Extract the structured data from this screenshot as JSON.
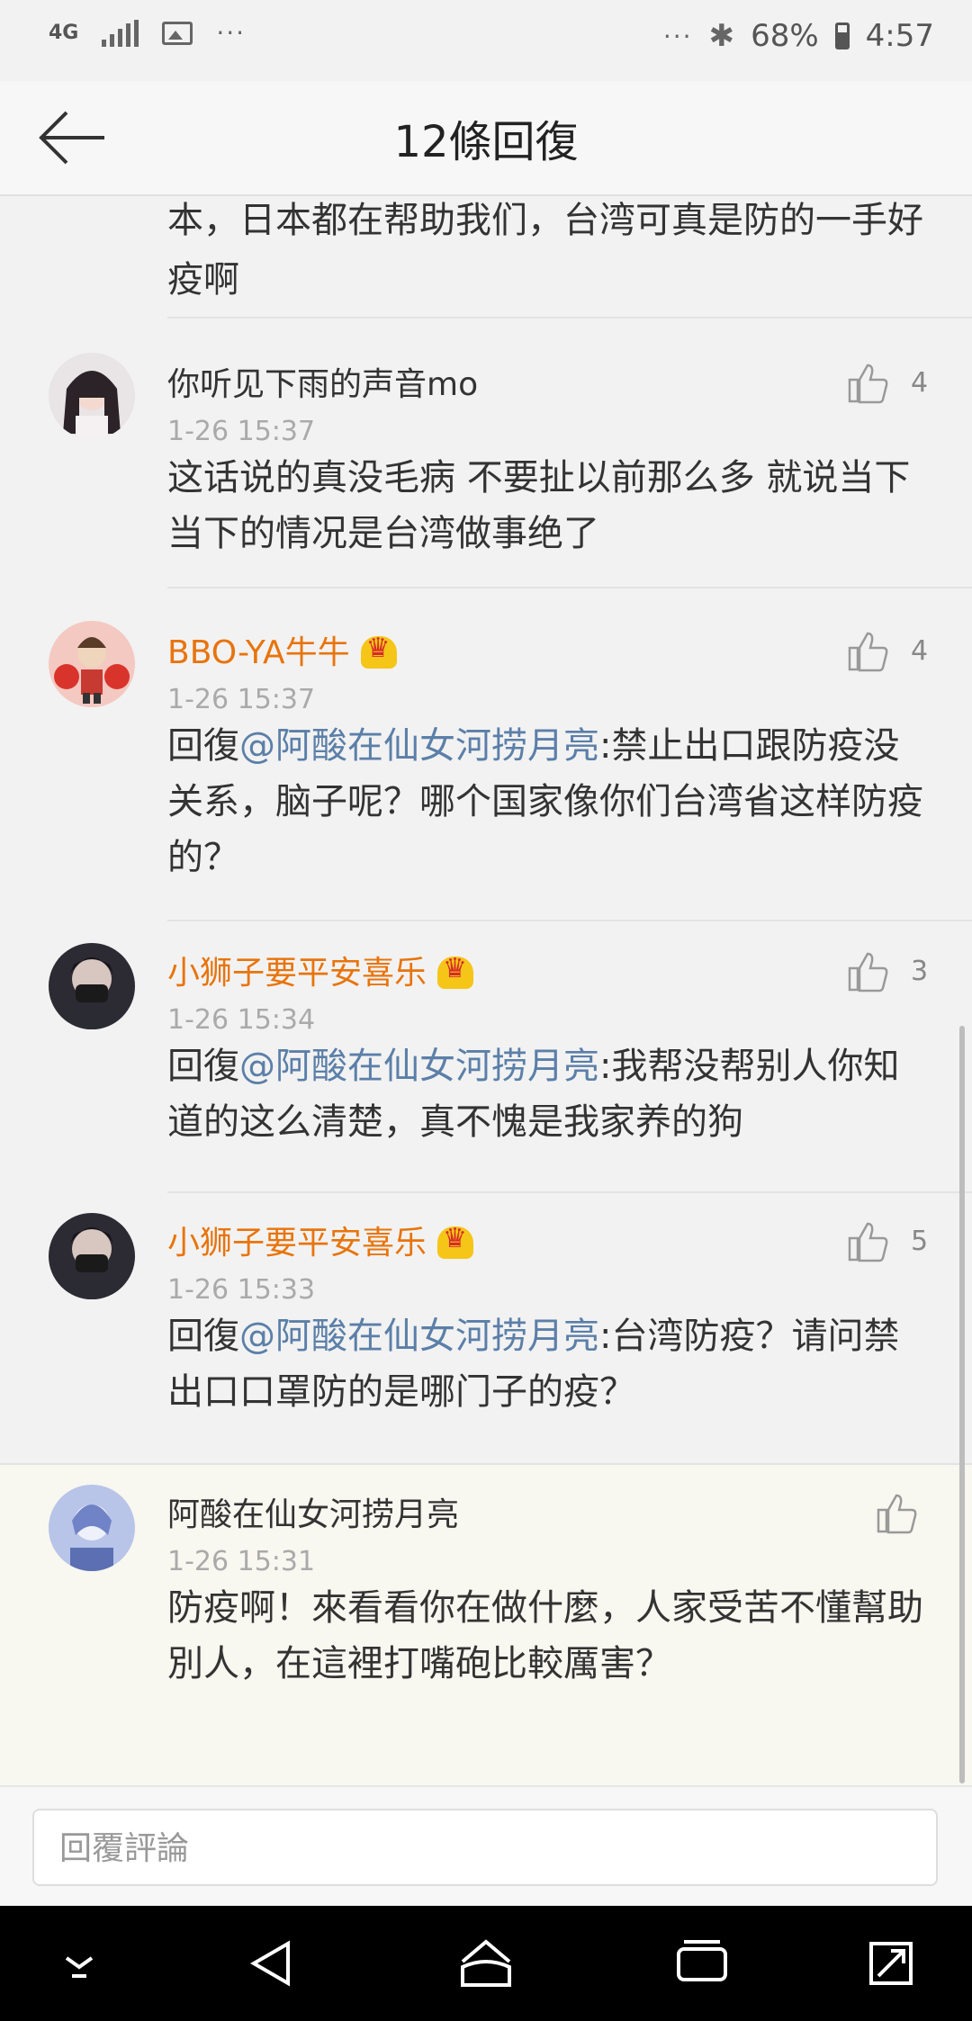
{
  "status_bar": {
    "network": "4G",
    "battery_percent": "68%",
    "time": "4:57",
    "more": "···"
  },
  "header": {
    "title": "12條回復"
  },
  "comments": [
    {
      "content": "本，日本都在帮助我们，台湾可真是防的一手好疫啊"
    },
    {
      "username": "你听见下雨的声音mo",
      "time": "1-26 15:37",
      "likes": "4",
      "content": "这话说的真没毛病 不要扯以前那么多 就说当下 当下的情况是台湾做事绝了"
    },
    {
      "username": "BBO-YA牛牛",
      "time": "1-26 15:37",
      "likes": "4",
      "reply_prefix": "回復",
      "mention": "@阿酸在仙女河捞月亮",
      "content": ":禁止出口跟防疫没关系，脑子呢？哪个国家像你们台湾省这样防疫的？"
    },
    {
      "username": "小狮子要平安喜乐",
      "time": "1-26 15:34",
      "likes": "3",
      "reply_prefix": "回復",
      "mention": "@阿酸在仙女河捞月亮",
      "content": ":我帮没帮别人你知道的这么清楚，真不愧是我家养的狗"
    },
    {
      "username": "小狮子要平安喜乐",
      "time": "1-26 15:33",
      "likes": "5",
      "reply_prefix": "回復",
      "mention": "@阿酸在仙女河捞月亮",
      "content": ":台湾防疫？请问禁出口口罩防的是哪门子的疫？"
    },
    {
      "username": "阿酸在仙女河捞月亮",
      "time": "1-26 15:31",
      "content": "防疫啊！來看看你在做什麼，人家受苦不懂幫助別人，在這裡打嘴砲比較厲害？"
    }
  ],
  "reply_bar": {
    "placeholder": "回覆評論"
  },
  "icons": [
    "back-arrow-icon",
    "thumbs-up-icon",
    "crown-icon",
    "nav-down-icon",
    "nav-back-icon",
    "nav-home-icon",
    "nav-recents-icon",
    "nav-expand-icon"
  ],
  "colors": {
    "vip_name": "#e8740c",
    "mention": "#5b7fa8",
    "time": "#aaaaaa"
  }
}
